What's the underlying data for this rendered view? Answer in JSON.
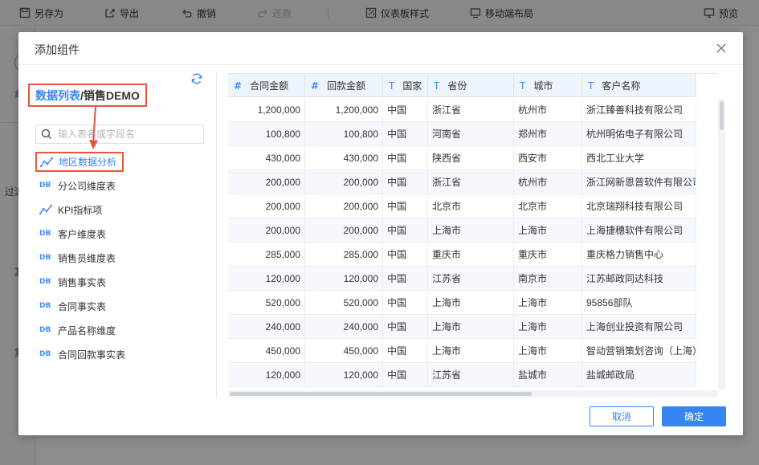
{
  "toolbar": {
    "save_as": "另存为",
    "export": "导出",
    "undo": "撤销",
    "redo": "还原",
    "dashboard_style": "仪表板样式",
    "mobile_layout": "移动端布局",
    "preview": "预览"
  },
  "workspace": {
    "glyph_1": "纟",
    "glyph_2": "过滤",
    "glyph_3": "其",
    "glyph_4": "复"
  },
  "dialog": {
    "title": "添加组件",
    "breadcrumb": {
      "parent": "数据列表",
      "separator": "/",
      "current": "销售DEMO"
    },
    "search_placeholder": "输入表名或字段名",
    "items": [
      {
        "label": "地区数据分析",
        "icon": "line-chart-icon",
        "highlighted": true
      },
      {
        "label": "分公司维度表",
        "icon": "db-icon"
      },
      {
        "label": "KPI指标项",
        "icon": "line-chart-icon"
      },
      {
        "label": "客户维度表",
        "icon": "db-icon"
      },
      {
        "label": "销售员维度表",
        "icon": "db-icon"
      },
      {
        "label": "销售事实表",
        "icon": "db-icon"
      },
      {
        "label": "合同事实表",
        "icon": "db-icon"
      },
      {
        "label": "产品名称维度",
        "icon": "db-icon"
      },
      {
        "label": "合同回款事实表",
        "icon": "db-icon"
      }
    ],
    "db_icon_text": "DB",
    "cancel": "取消",
    "confirm": "确定"
  },
  "grid": {
    "columns": [
      {
        "type": "#",
        "label": "合同金额"
      },
      {
        "type": "#",
        "label": "回款金额"
      },
      {
        "type": "T",
        "label": "国家"
      },
      {
        "type": "T",
        "label": "省份"
      },
      {
        "type": "T",
        "label": "城市"
      },
      {
        "type": "T",
        "label": "客户名称"
      }
    ],
    "rows": [
      [
        "1,200,000",
        "1,200,000",
        "中国",
        "浙江省",
        "杭州市",
        "浙江臻善科技有限公司"
      ],
      [
        "100,800",
        "100,800",
        "中国",
        "河南省",
        "郑州市",
        "杭州明佑电子有限公司"
      ],
      [
        "430,000",
        "430,000",
        "中国",
        "陕西省",
        "西安市",
        "西北工业大学"
      ],
      [
        "200,000",
        "200,000",
        "中国",
        "浙江省",
        "杭州市",
        "浙江网新恩普软件有限公司"
      ],
      [
        "200,000",
        "200,000",
        "中国",
        "北京市",
        "北京市",
        "北京瑞翔科技有限公司"
      ],
      [
        "200,000",
        "200,000",
        "中国",
        "上海市",
        "上海市",
        "上海捷穗软件有限公司"
      ],
      [
        "285,000",
        "285,000",
        "中国",
        "重庆市",
        "重庆市",
        "重庆格力销售中心"
      ],
      [
        "120,000",
        "120,000",
        "中国",
        "江苏省",
        "南京市",
        "江苏邮政同达科技"
      ],
      [
        "520,000",
        "520,000",
        "中国",
        "上海市",
        "上海市",
        "95856部队"
      ],
      [
        "240,000",
        "240,000",
        "中国",
        "上海市",
        "上海市",
        "上海创业投资有限公司"
      ],
      [
        "450,000",
        "450,000",
        "中国",
        "上海市",
        "上海市",
        "智动营销策划咨询（上海）"
      ],
      [
        "120,000",
        "120,000",
        "中国",
        "江苏省",
        "盐城市",
        "盐城邮政局"
      ]
    ]
  },
  "colors": {
    "accent": "#3685f2",
    "highlight_border": "#e8553e",
    "header_bg": "#eef4fc",
    "alt_row_bg": "#f5f8fd"
  }
}
